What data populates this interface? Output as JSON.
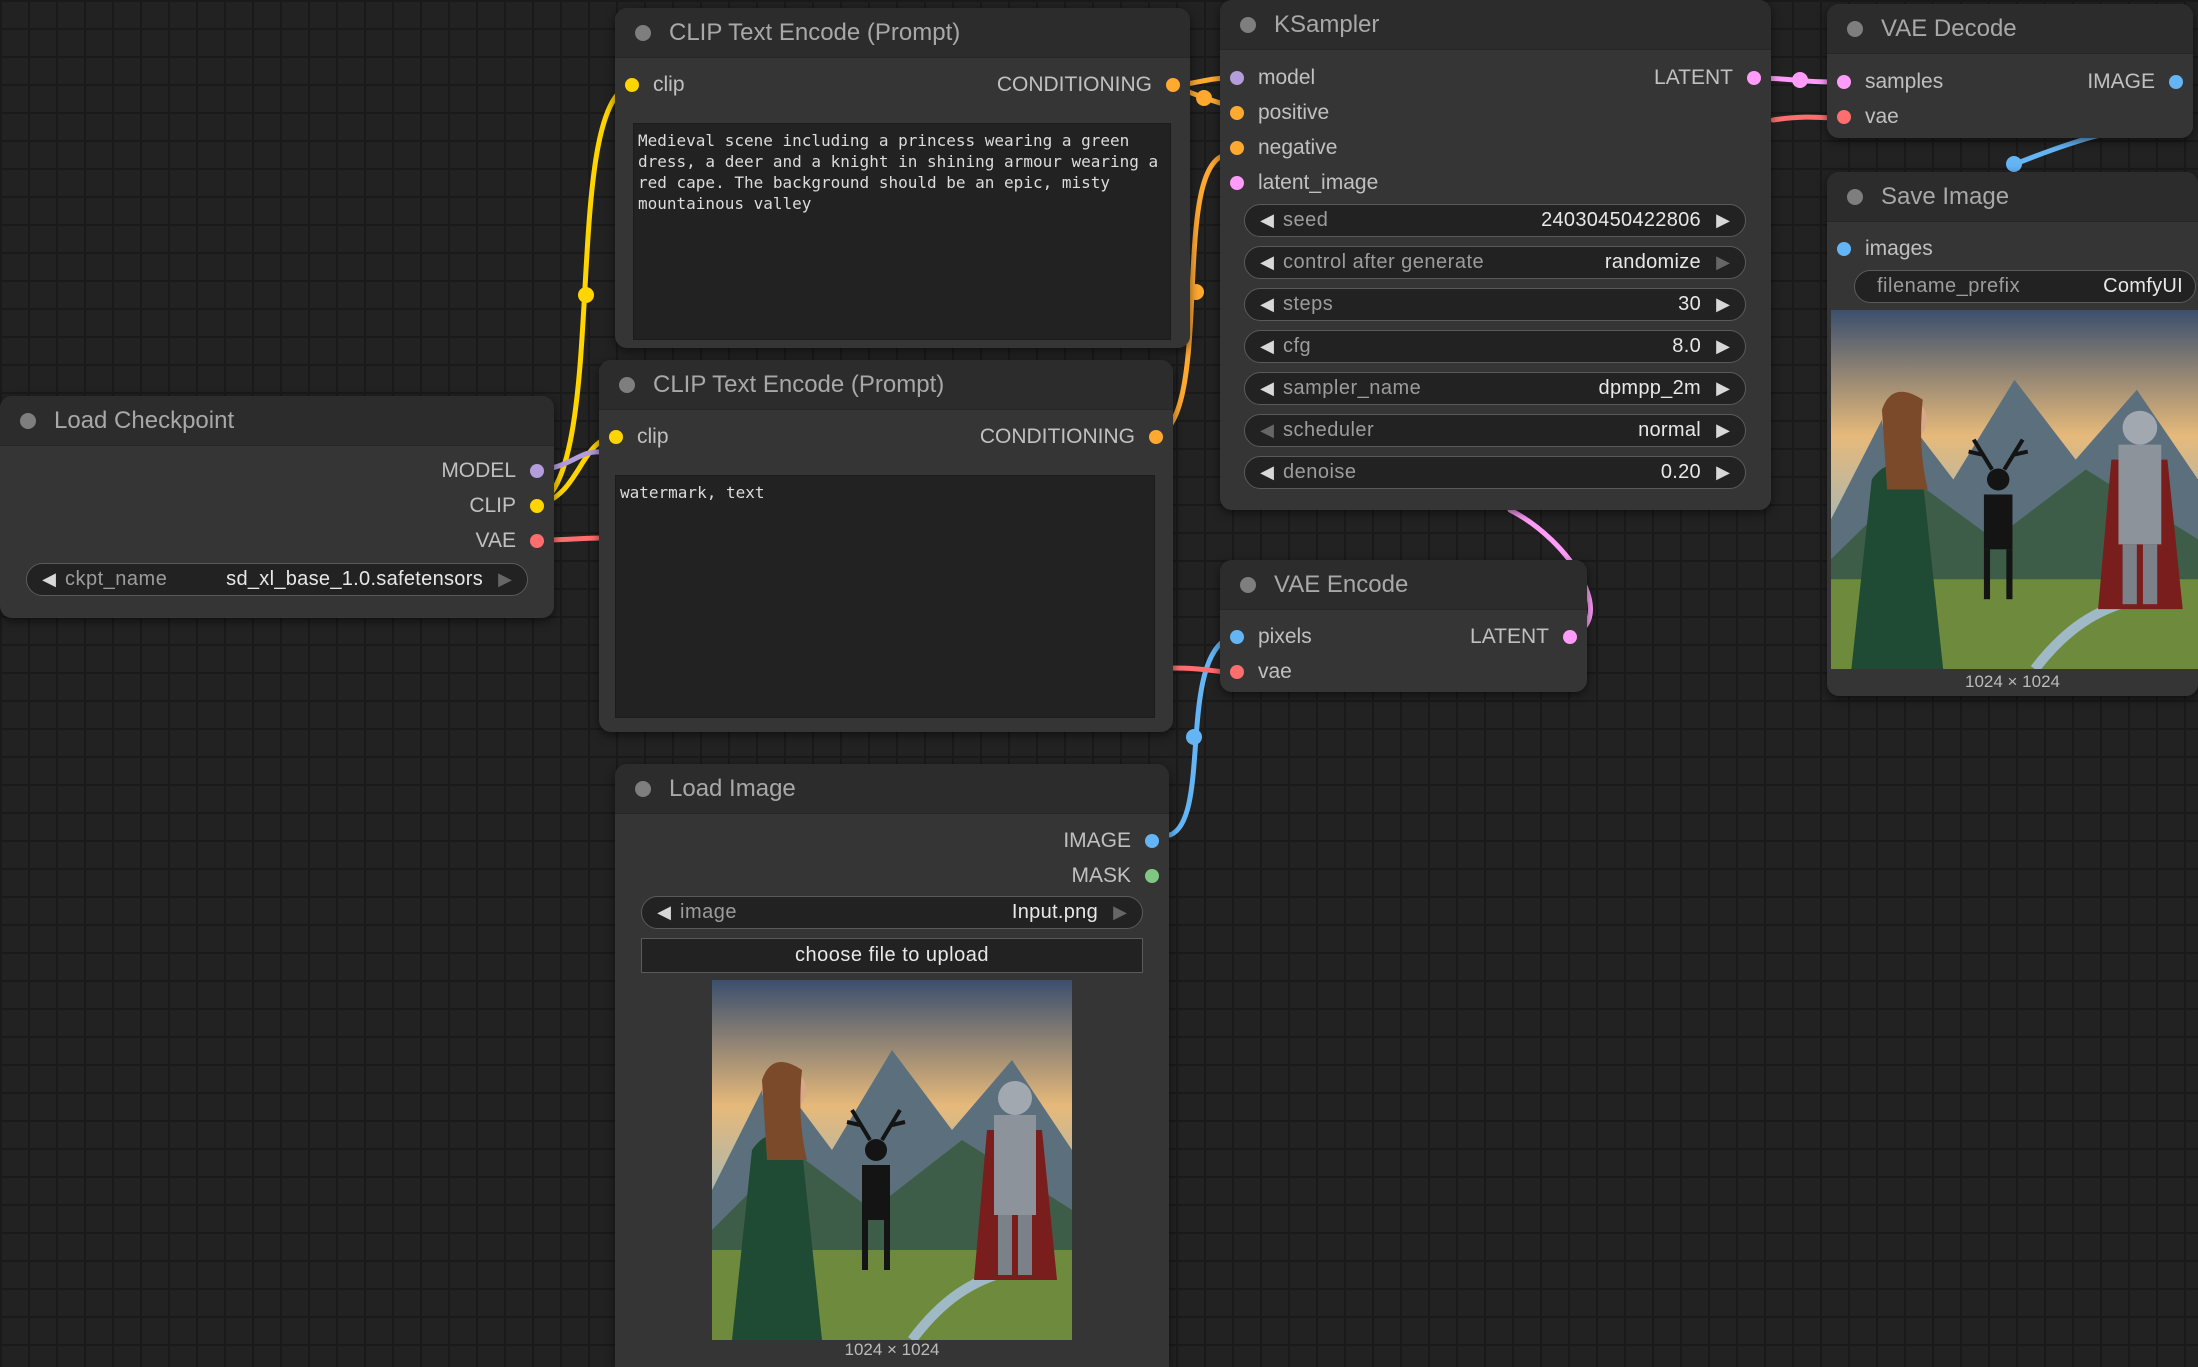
{
  "colors": {
    "model": "#b39ddb",
    "clip": "#ffd500",
    "vae": "#ff6e6e",
    "conditioning": "#ffa931",
    "latent": "#ff9cf9",
    "image": "#64b5f6",
    "mask": "#81c784"
  },
  "nodes": {
    "load_checkpoint": {
      "title": "Load Checkpoint",
      "outputs": [
        "MODEL",
        "CLIP",
        "VAE"
      ],
      "widget": {
        "name": "ckpt_name",
        "value": "sd_xl_base_1.0.safetensors"
      }
    },
    "clip_positive": {
      "title": "CLIP Text Encode (Prompt)",
      "input": "clip",
      "output": "CONDITIONING",
      "text": "Medieval scene including a princess wearing a green dress, a deer and a knight in shining armour wearing a red cape. The background should be an epic, misty mountainous valley"
    },
    "clip_negative": {
      "title": "CLIP Text Encode (Prompt)",
      "input": "clip",
      "output": "CONDITIONING",
      "text": "watermark, text"
    },
    "ksampler": {
      "title": "KSampler",
      "inputs": [
        "model",
        "positive",
        "negative",
        "latent_image"
      ],
      "output": "LATENT",
      "widgets": [
        {
          "name": "seed",
          "value": "24030450422806"
        },
        {
          "name": "control after generate",
          "value": "randomize"
        },
        {
          "name": "steps",
          "value": "30"
        },
        {
          "name": "cfg",
          "value": "8.0"
        },
        {
          "name": "sampler_name",
          "value": "dpmpp_2m"
        },
        {
          "name": "scheduler",
          "value": "normal"
        },
        {
          "name": "denoise",
          "value": "0.20"
        }
      ]
    },
    "vae_decode": {
      "title": "VAE Decode",
      "inputs": [
        "samples",
        "vae"
      ],
      "output": "IMAGE"
    },
    "save_image": {
      "title": "Save Image",
      "input": "images",
      "widget": {
        "name": "filename_prefix",
        "value": "ComfyUI"
      },
      "dims": "1024 × 1024"
    },
    "vae_encode": {
      "title": "VAE Encode",
      "inputs": [
        "pixels",
        "vae"
      ],
      "output": "LATENT"
    },
    "load_image": {
      "title": "Load Image",
      "outputs": [
        "IMAGE",
        "MASK"
      ],
      "widget": {
        "name": "image",
        "value": "Input.png"
      },
      "button": "choose file to upload",
      "dims": "1024 × 1024"
    }
  }
}
